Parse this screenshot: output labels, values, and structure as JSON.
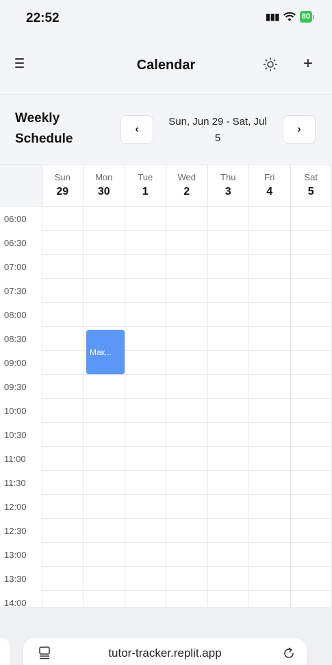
{
  "status": {
    "time": "22:52",
    "battery": "80"
  },
  "header": {
    "title": "Calendar"
  },
  "schedule": {
    "title_line1": "Weekly",
    "title_line2": "Schedule",
    "range_line1": "Sun, Jun 29 - Sat, Jul",
    "range_line2": "5",
    "prev_label": "‹",
    "next_label": "›"
  },
  "days": [
    {
      "name": "Sun",
      "num": "29"
    },
    {
      "name": "Mon",
      "num": "30"
    },
    {
      "name": "Tue",
      "num": "1"
    },
    {
      "name": "Wed",
      "num": "2"
    },
    {
      "name": "Thu",
      "num": "3"
    },
    {
      "name": "Fri",
      "num": "4"
    },
    {
      "name": "Sat",
      "num": "5"
    }
  ],
  "times": [
    "06:00",
    "06:30",
    "07:00",
    "07:30",
    "08:00",
    "08:30",
    "09:00",
    "09:30",
    "10:00",
    "10:30",
    "11:00",
    "11:30",
    "12:00",
    "12:30",
    "13:00",
    "13:30",
    "14:00"
  ],
  "events": [
    {
      "label": "Мак...",
      "day": "Mon",
      "start": "08:30",
      "end": "09:00",
      "color": "#5b97f7"
    }
  ],
  "browser": {
    "url": "tutor-tracker.replit.app"
  },
  "colors": {
    "accent": "#5b97f7",
    "battery": "#35c759"
  }
}
